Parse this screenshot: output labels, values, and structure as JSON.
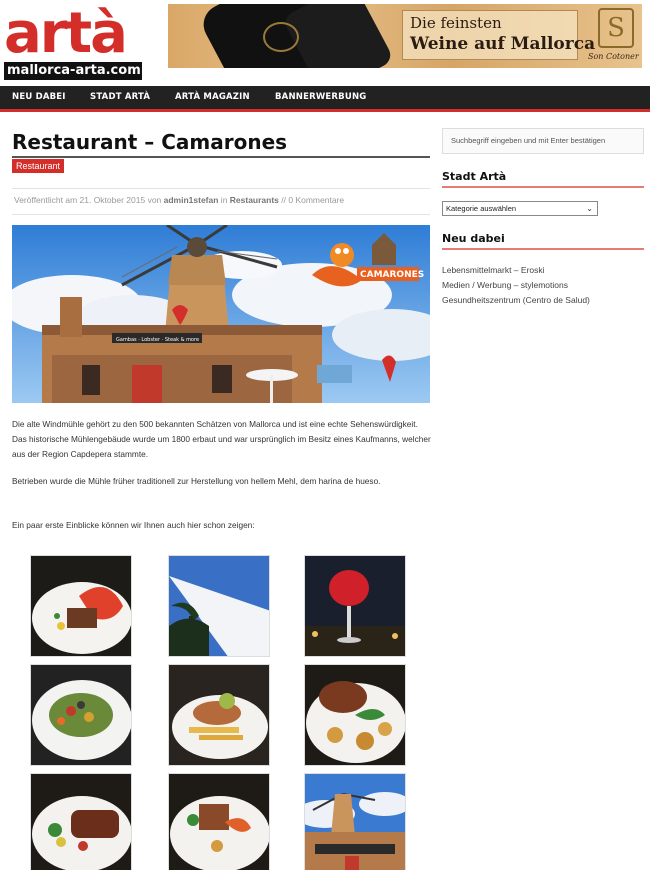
{
  "logo": {
    "main": "artà",
    "sub": "mallorca-arta.com"
  },
  "banner": {
    "line1": "Die feinsten",
    "line2": "Weine auf Mallorca",
    "seal": "S",
    "brand": "Son Cotoner"
  },
  "nav": [
    {
      "label": "NEU DABEI"
    },
    {
      "label": "STADT ARTÀ"
    },
    {
      "label": "ARTÀ MAGAZIN"
    },
    {
      "label": "BANNERWERBUNG"
    }
  ],
  "post": {
    "title": "Restaurant – Camarones",
    "category": "Restaurant",
    "meta_prefix": "Veröffentlicht am 21. Oktober 2015 von ",
    "author": "admin1stefan",
    "meta_in": " in ",
    "meta_category": "Restaurants",
    "meta_comments": " // 0 Kommentare",
    "hero_sign": "CAMARONES",
    "hero_banner": "Gambas · Lobster · Steak & more",
    "paragraph1": "Die alte Windmühle gehört zu den 500 bekannten Schätzen von Mallorca und ist eine echte Sehenswürdigkeit. Das historische Mühlengebäude wurde um 1800 erbaut und war ursprünglich im Besitz eines Kaufmanns, welcher aus der Region Capdepera stammte.",
    "paragraph2": "Betrieben wurde die Mühle früher traditionell zur Herstellung von hellem Mehl, dem harina de hueso.",
    "paragraph3": "Ein paar erste Einblicke können wir Ihnen auch hier schon zeigen:"
  },
  "sidebar": {
    "search_placeholder": "Suchbegriff eingeben und mit Enter bestätigen",
    "stadt_heading": "Stadt Artà",
    "select_value": "Kategorie auswählen",
    "neu_heading": "Neu dabei",
    "links": [
      {
        "label": "Lebensmittelmarkt – Eroski"
      },
      {
        "label": "Medien / Werbung – stylemotions"
      },
      {
        "label": "Gesundheitszentrum (Centro de Salud)"
      }
    ]
  },
  "colors": {
    "accent": "#d42e2a",
    "nav_bg": "#222222"
  },
  "gallery": [
    {
      "icon": "lobster-plate-photo"
    },
    {
      "icon": "palm-sail-photo"
    },
    {
      "icon": "cocktail-photo"
    },
    {
      "icon": "salad-plate-photo"
    },
    {
      "icon": "fish-fries-photo"
    },
    {
      "icon": "steak-potatoes-photo"
    },
    {
      "icon": "steak-veg-photo"
    },
    {
      "icon": "shrimp-plate-photo"
    },
    {
      "icon": "windmill-photo"
    }
  ]
}
